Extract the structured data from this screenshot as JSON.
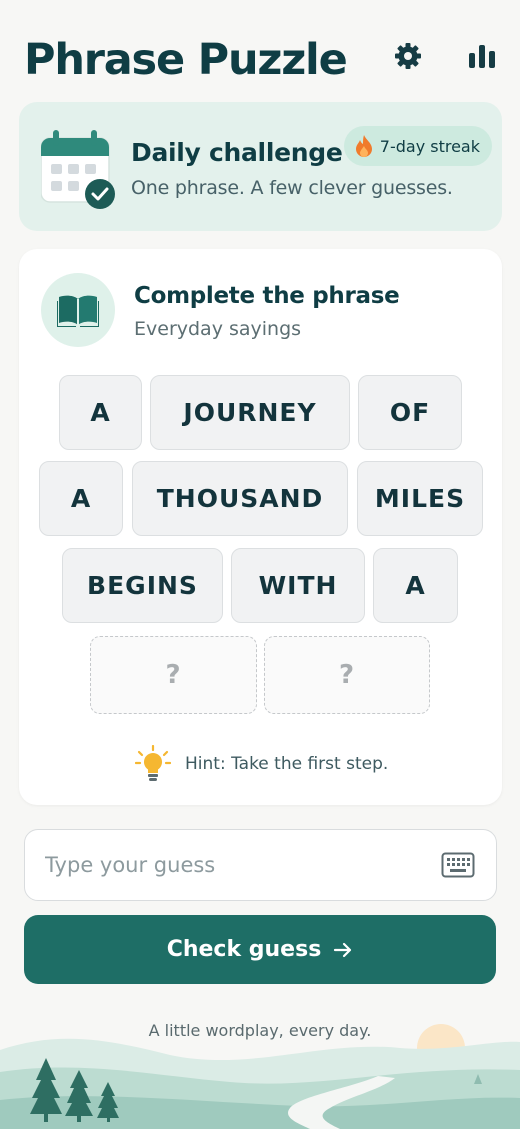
{
  "app": {
    "title": "Phrase Puzzle",
    "icons": [
      "gear-icon",
      "bar-chart-icon"
    ]
  },
  "daily": {
    "title": "Daily challenge",
    "subtitle": "One phrase. A few clever guesses.",
    "streak_label": "7-day streak",
    "icons": [
      "calendar-check-icon",
      "flame-icon"
    ]
  },
  "puzzle": {
    "title": "Complete the phrase",
    "subtitle": "Everyday sayings",
    "words": [
      "A",
      "JOURNEY",
      "OF",
      "A",
      "THOUSAND",
      "MILES",
      "BEGINS",
      "WITH",
      "A",
      "?",
      "?"
    ],
    "hint": "Hint: Take the first step.",
    "icons": [
      "book-icon",
      "lightbulb-icon"
    ]
  },
  "guess": {
    "placeholder": "Type your guess",
    "value": "",
    "button_label": "Check guess",
    "icons": [
      "keyboard-icon",
      "arrow-right-icon"
    ]
  },
  "footer": {
    "tagline": "A little wordplay, every day."
  },
  "colors": {
    "accent": "#1e6e66",
    "title": "#0f3d44",
    "daily_bg": "#e3f1ec",
    "streak_bg": "#cdeadf",
    "flame": "#f07b2c",
    "bulb": "#f5b731"
  }
}
